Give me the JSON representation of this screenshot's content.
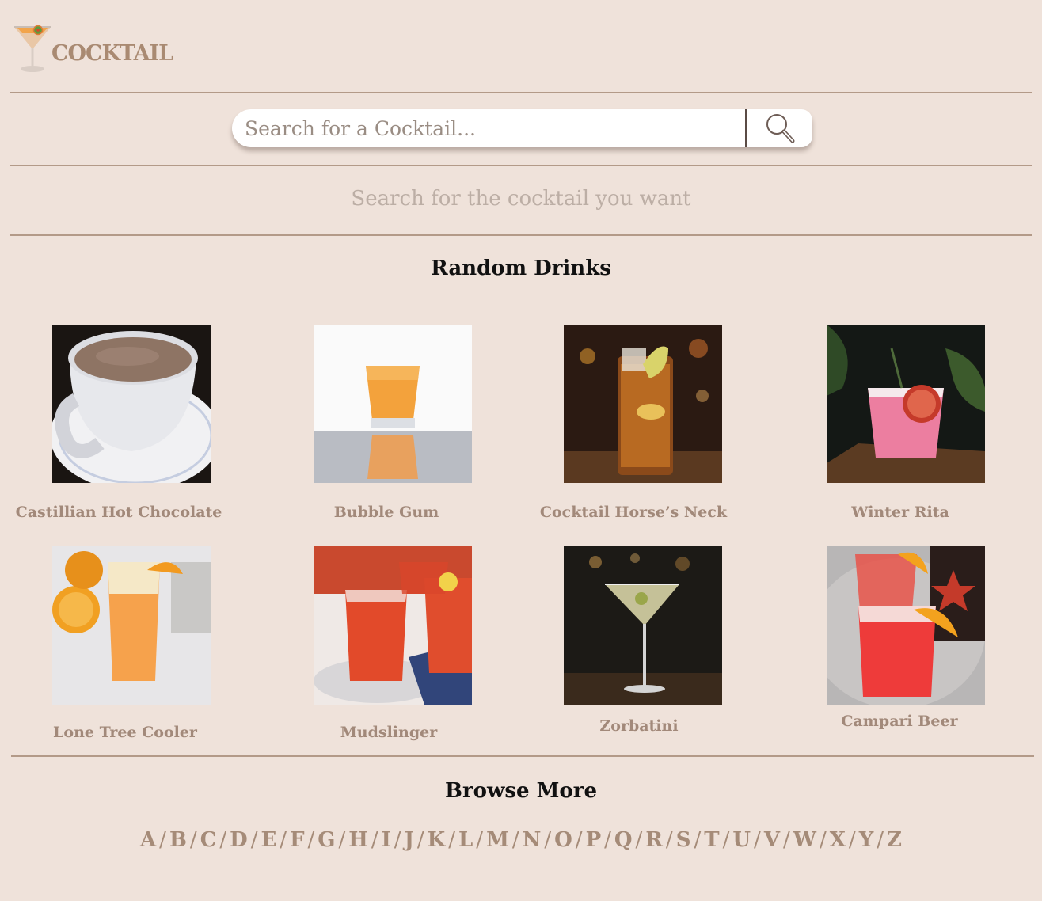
{
  "header": {
    "brand": "COCKTAIL"
  },
  "search": {
    "placeholder": "Search for a Cocktail..."
  },
  "hint": "Search for the cocktail you want",
  "random_title": "Random Drinks",
  "drinks": [
    {
      "name": "Castillian Hot Chocolate"
    },
    {
      "name": "Bubble Gum"
    },
    {
      "name": "Cocktail Horse’s Neck"
    },
    {
      "name": "Winter Rita"
    },
    {
      "name": "Lone Tree Cooler"
    },
    {
      "name": "Mudslinger"
    },
    {
      "name": "Zorbatini"
    },
    {
      "name": "Campari Beer"
    }
  ],
  "browse_title": "Browse More",
  "letters": [
    "A",
    "B",
    "C",
    "D",
    "E",
    "F",
    "G",
    "H",
    "I",
    "J",
    "K",
    "L",
    "M",
    "N",
    "O",
    "P",
    "Q",
    "R",
    "S",
    "T",
    "U",
    "V",
    "W",
    "X",
    "Y",
    "Z"
  ],
  "letter_separator": "/",
  "colors": {
    "background": "#efe2da",
    "accent": "#a98a72",
    "divider": "#b39a88"
  }
}
